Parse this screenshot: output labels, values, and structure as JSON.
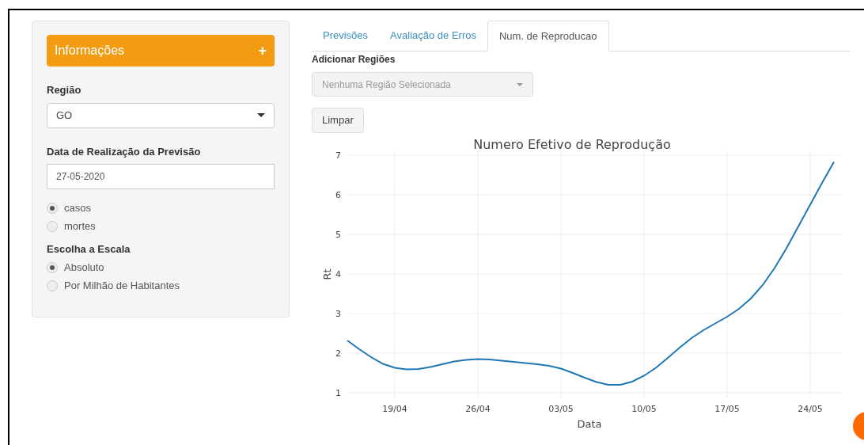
{
  "sidebar": {
    "header": {
      "title": "Informações",
      "toggle": "+"
    },
    "region": {
      "label": "Região",
      "value": "GO"
    },
    "date": {
      "label": "Data de Realização da Previsão",
      "value": "27-05-2020"
    },
    "series_options": [
      {
        "label": "casos",
        "selected": true
      },
      {
        "label": "mortes",
        "selected": false
      }
    ],
    "scale": {
      "label": "Escolha a Escala",
      "options": [
        {
          "label": "Absoluto",
          "selected": true
        },
        {
          "label": "Por Milhão de Habitantes",
          "selected": false
        }
      ]
    }
  },
  "tabs": [
    {
      "label": "Previsões",
      "selected": false
    },
    {
      "label": "Avaliação de Erros",
      "selected": false
    },
    {
      "label": "Num. de Reproducao",
      "selected": true
    }
  ],
  "add_regions": {
    "label": "Adicionar Regiões",
    "placeholder": "Nenhuma Região Selecionada",
    "disabled": true
  },
  "clear_button": "Limpar",
  "chart_data": {
    "type": "line",
    "title": "Numero Efetivo de Reprodução",
    "xlabel": "Data",
    "ylabel": "Rt",
    "categories": [
      null,
      null,
      null,
      null,
      "19/04",
      null,
      null,
      null,
      null,
      null,
      null,
      "26/04",
      null,
      null,
      null,
      null,
      null,
      null,
      "03/05",
      null,
      null,
      null,
      null,
      null,
      null,
      "10/05",
      null,
      null,
      null,
      null,
      null,
      null,
      "17/05",
      null,
      null,
      null,
      null,
      null,
      null,
      "24/05",
      null,
      null
    ],
    "grid": true,
    "series": [
      {
        "color": "#1f77b4",
        "values": [
          2.32,
          2.1,
          1.9,
          1.73,
          1.63,
          1.59,
          1.6,
          1.65,
          1.72,
          1.79,
          1.83,
          1.85,
          1.84,
          1.81,
          1.78,
          1.75,
          1.72,
          1.68,
          1.61,
          1.5,
          1.38,
          1.27,
          1.2,
          1.2,
          1.28,
          1.43,
          1.63,
          1.88,
          2.14,
          2.38,
          2.58,
          2.75,
          2.92,
          3.12,
          3.38,
          3.72,
          4.15,
          4.65,
          5.2,
          5.75,
          6.3,
          6.83
        ]
      }
    ],
    "ylim": [
      0.88,
      7.1
    ],
    "yticks": [
      1,
      2,
      3,
      4,
      5,
      6,
      7
    ]
  }
}
